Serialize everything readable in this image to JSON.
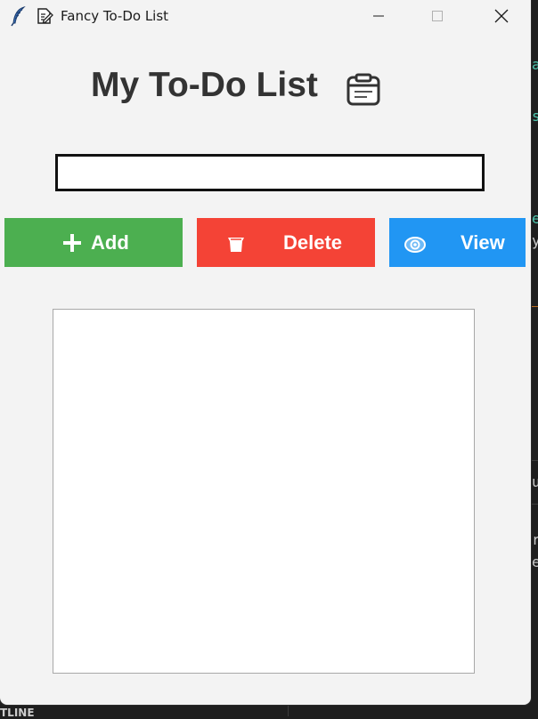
{
  "window": {
    "title": "Fancy To-Do List",
    "controls": {
      "minimize": "minimize",
      "maximize": "maximize",
      "close": "close"
    }
  },
  "app": {
    "heading": "My To-Do List",
    "heading_icon": "clipboard-icon",
    "input": {
      "value": "",
      "placeholder": ""
    },
    "buttons": {
      "add": {
        "label": "Add",
        "icon": "plus-icon",
        "color": "#4caf50"
      },
      "delete": {
        "label": "Delete",
        "icon": "trash-icon",
        "color": "#f44336"
      },
      "view": {
        "label": "View",
        "icon": "eye-icon",
        "color": "#2196f3"
      }
    },
    "tasks": []
  },
  "background": {
    "right_fragments": [
      "a",
      "s",
      "e",
      "y",
      "u",
      "r",
      "e"
    ],
    "bottom_text": "TLINE"
  }
}
